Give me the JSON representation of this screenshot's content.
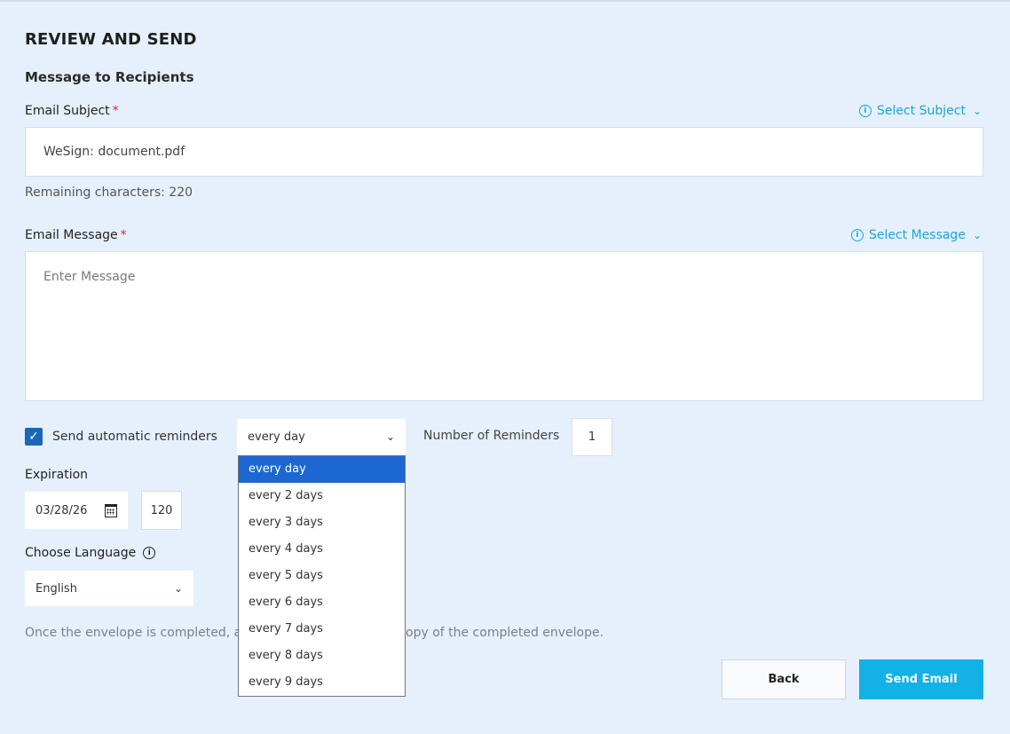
{
  "page_title": "REVIEW AND SEND",
  "section_title": "Message to Recipients",
  "email_subject": {
    "label": "Email Subject",
    "required_mark": "*",
    "select_link": "Select Subject",
    "value": "WeSign: document.pdf",
    "remaining": "Remaining characters: 220"
  },
  "email_message": {
    "label": "Email Message",
    "required_mark": "*",
    "select_link": "Select Message",
    "placeholder": "Enter Message"
  },
  "reminders": {
    "checked": true,
    "label": "Send automatic reminders",
    "frequency_selected": "every day",
    "frequency_options": [
      "every day",
      "every 2 days",
      "every 3 days",
      "every 4 days",
      "every 5 days",
      "every 6 days",
      "every 7 days",
      "every 8 days",
      "every 9 days"
    ],
    "number_label": "Number of Reminders",
    "number_value": "1"
  },
  "expiration": {
    "label": "Expiration",
    "date": "03/28/26",
    "days": "120"
  },
  "language": {
    "label": "Choose Language",
    "selected": "English"
  },
  "note_left": "Once the envelope is completed, a",
  "note_right": "opy of the completed envelope.",
  "buttons": {
    "back": "Back",
    "send": "Send Email"
  },
  "colors": {
    "background": "#e6f0fc",
    "accent": "#13b1e6",
    "selected_option": "#1c67d2",
    "required": "#d9262f"
  }
}
